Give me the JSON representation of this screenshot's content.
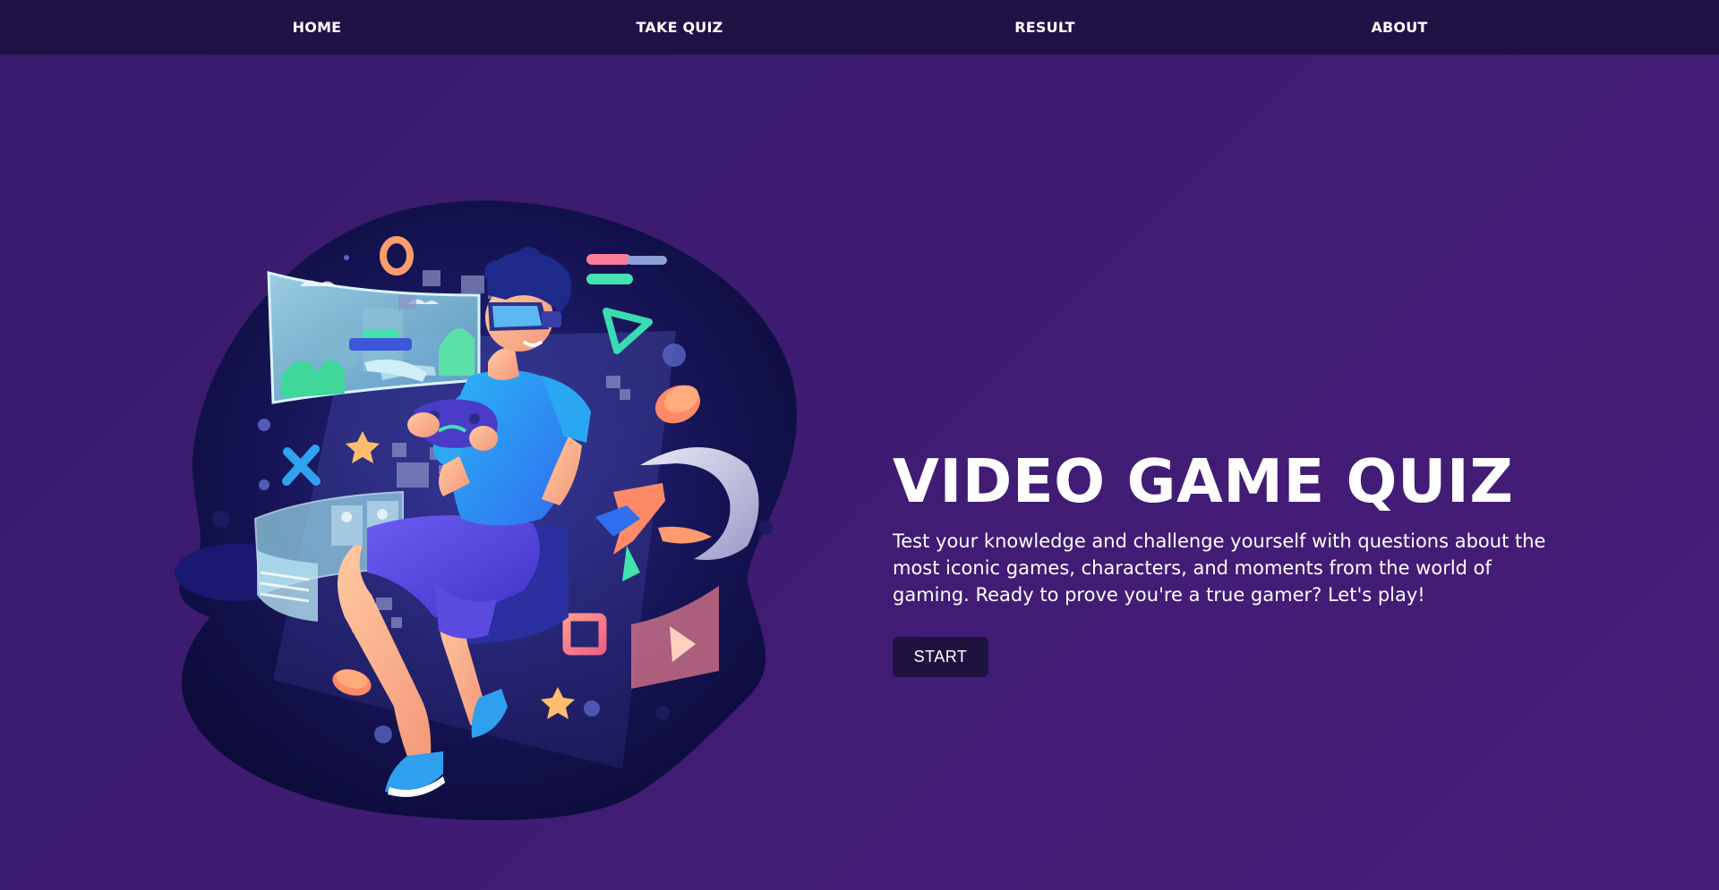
{
  "nav": {
    "items": [
      {
        "label": "HOME"
      },
      {
        "label": "TAKE QUIZ"
      },
      {
        "label": "RESULT"
      },
      {
        "label": "ABOUT"
      }
    ]
  },
  "hero": {
    "title": "VIDEO GAME QUIZ",
    "description": "Test your knowledge and challenge yourself with questions about the most iconic games, characters, and moments from the world of gaming. Ready to prove you're a true gamer? Let's play!",
    "button_label": "START",
    "illustration": "vr-gamer-illustration"
  },
  "colors": {
    "nav_bg": "#211246",
    "page_bg": "#3f1c74",
    "button_bg": "#1e1340",
    "text": "#ffffff"
  }
}
